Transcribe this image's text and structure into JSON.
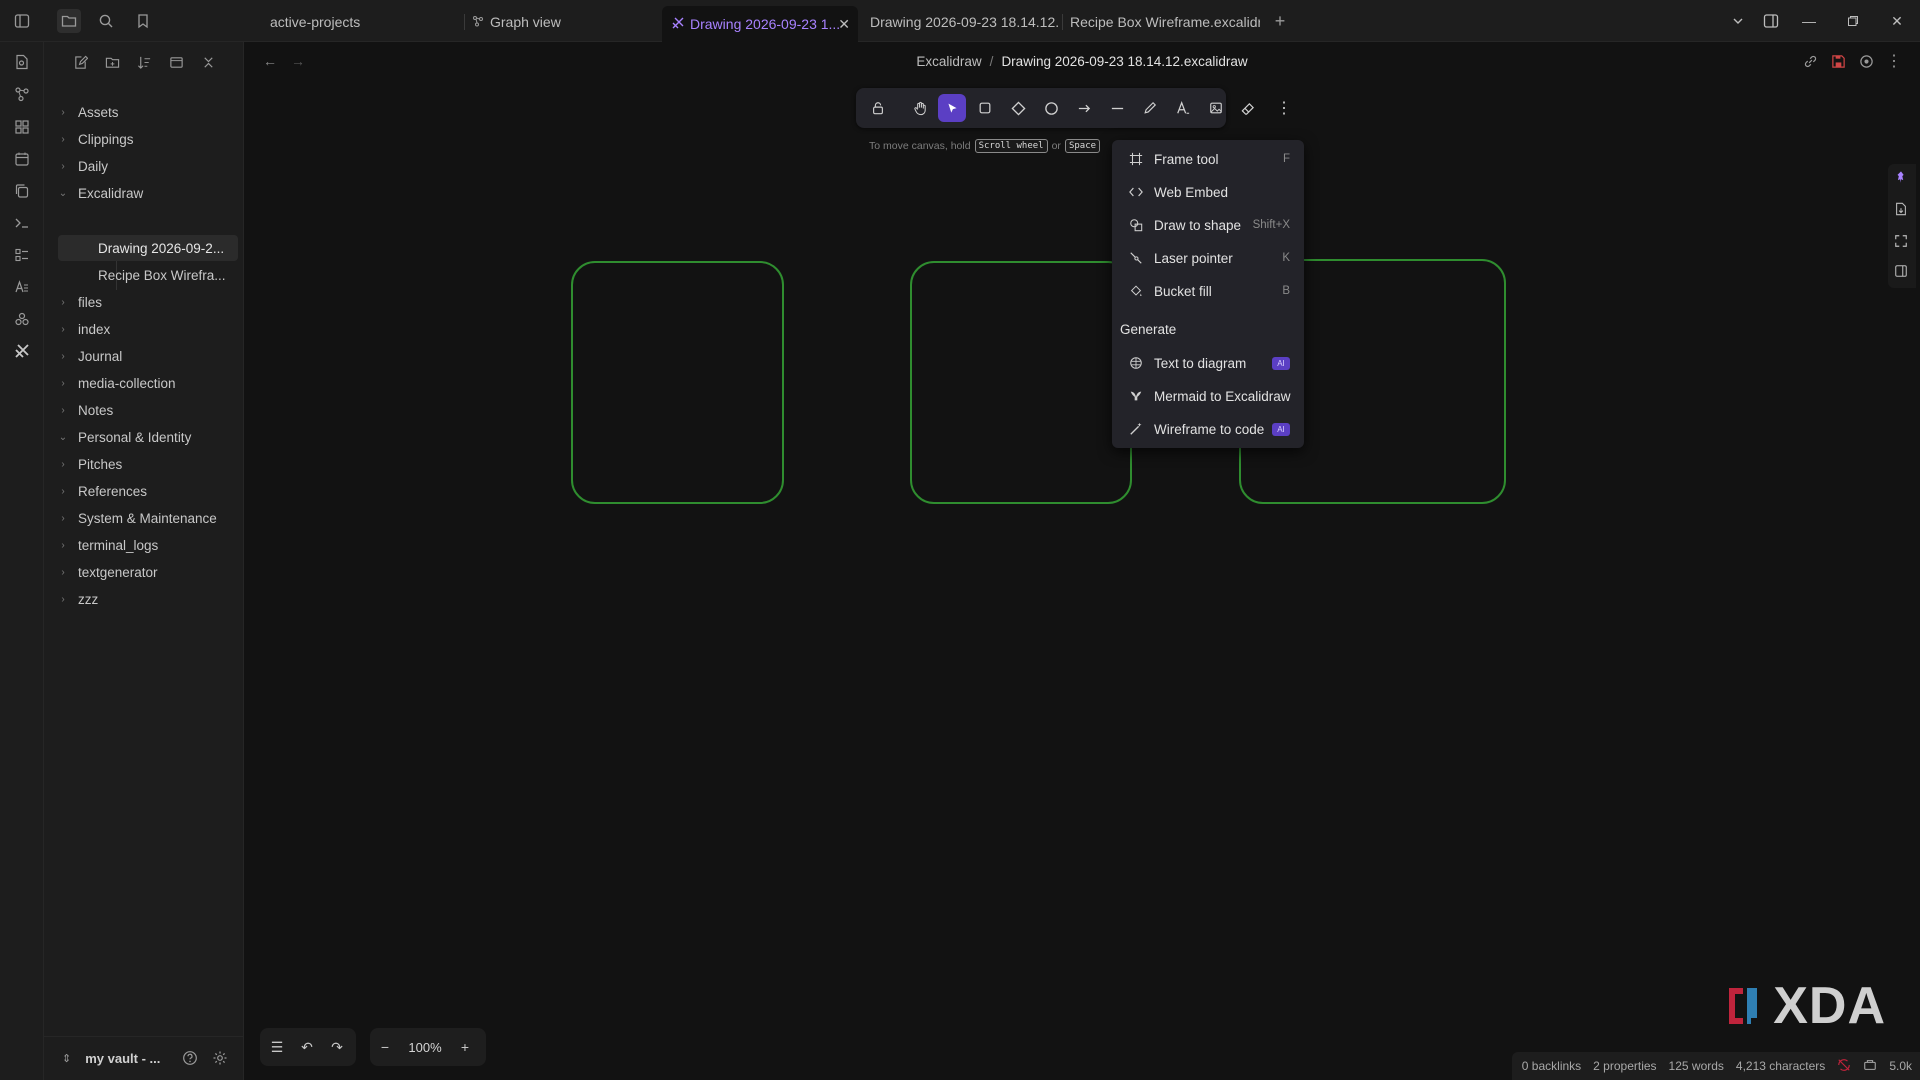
{
  "tabs": [
    {
      "label": "active-projects",
      "icon": ""
    },
    {
      "label": "Graph view",
      "icon": "graph-icon"
    },
    {
      "label": "Drawing 2026-09-23 1...",
      "icon": "excalidraw-icon",
      "active": true
    },
    {
      "label": "Drawing 2026-09-23 18.14.12....",
      "icon": ""
    },
    {
      "label": "Recipe Box Wireframe.excalidr...",
      "icon": ""
    }
  ],
  "sidebar": {
    "tree": [
      {
        "label": "Assets",
        "expanded": false
      },
      {
        "label": "Clippings",
        "expanded": false
      },
      {
        "label": "Daily",
        "expanded": false
      },
      {
        "label": "Excalidraw",
        "expanded": true
      },
      {
        "label": "Drawing 2026-09-2...",
        "child": true,
        "selected": true
      },
      {
        "label": "Recipe Box Wirefra...",
        "child": true
      },
      {
        "label": "files",
        "expanded": false
      },
      {
        "label": "index",
        "expanded": false
      },
      {
        "label": "Journal",
        "expanded": false
      },
      {
        "label": "media-collection",
        "expanded": false
      },
      {
        "label": "Notes",
        "expanded": false
      },
      {
        "label": "Personal & Identity",
        "expanded": true
      },
      {
        "label": "Pitches",
        "expanded": false
      },
      {
        "label": "References",
        "expanded": false
      },
      {
        "label": "System & Maintenance",
        "expanded": false
      },
      {
        "label": "terminal_logs",
        "expanded": false
      },
      {
        "label": "textgenerator",
        "expanded": false
      },
      {
        "label": "zzz",
        "expanded": false
      }
    ],
    "vault_name": "my vault - ..."
  },
  "breadcrumb": {
    "folder": "Excalidraw",
    "separator": "/",
    "file": "Drawing 2026-09-23 18.14.12.excalidraw"
  },
  "canvas": {
    "hint_prefix": "To move canvas, hold",
    "hint_key1": "Scroll wheel",
    "hint_or": "or",
    "hint_key2": "Space",
    "shape_stroke_color": "#2f8d2f"
  },
  "dropdown": {
    "items": [
      {
        "label": "Frame tool",
        "shortcut": "F",
        "icon": "frame-icon"
      },
      {
        "label": "Web Embed",
        "shortcut": "",
        "icon": "embed-icon"
      },
      {
        "label": "Draw to shape",
        "shortcut": "Shift+X",
        "icon": "shapes-icon"
      },
      {
        "label": "Laser pointer",
        "shortcut": "K",
        "icon": "laser-icon"
      },
      {
        "label": "Bucket fill",
        "shortcut": "B",
        "icon": "bucket-icon"
      }
    ],
    "generate_heading": "Generate",
    "generate_items": [
      {
        "label": "Text to diagram",
        "badge": "AI",
        "icon": "brain-icon"
      },
      {
        "label": "Mermaid to Excalidraw",
        "badge": "",
        "icon": "mermaid-icon"
      },
      {
        "label": "Wireframe to code",
        "badge": "AI",
        "icon": "wand-icon"
      }
    ]
  },
  "zoom": {
    "level": "100%"
  },
  "status": {
    "backlinks": "0 backlinks",
    "properties": "2 properties",
    "words": "125 words",
    "characters": "4,213 characters",
    "size": "5.0k"
  },
  "watermark": {
    "text": "XDA"
  },
  "colors": {
    "accent": "#a882ff",
    "active_tool": "#5b3fc4",
    "background": "#121212"
  }
}
